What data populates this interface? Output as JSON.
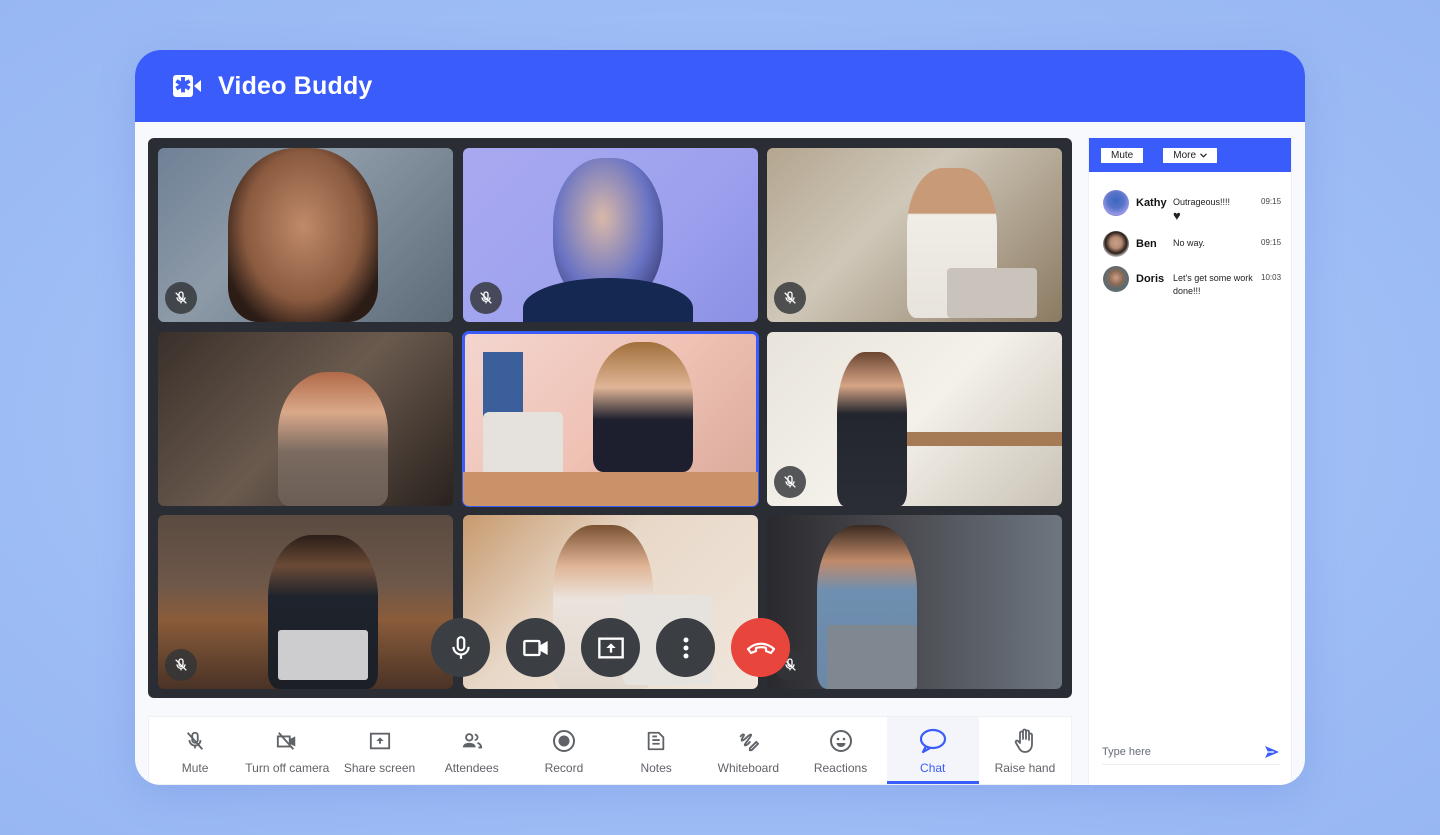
{
  "app": {
    "title": "Video Buddy",
    "logo_icon": "video-camera-icon"
  },
  "participants": [
    {
      "name": "participant-1",
      "muted": true,
      "active": false
    },
    {
      "name": "participant-2",
      "muted": true,
      "active": false
    },
    {
      "name": "participant-3",
      "muted": true,
      "active": false
    },
    {
      "name": "participant-4",
      "muted": false,
      "active": false
    },
    {
      "name": "participant-5",
      "muted": false,
      "active": true
    },
    {
      "name": "participant-6",
      "muted": true,
      "active": false
    },
    {
      "name": "participant-7",
      "muted": true,
      "active": false
    },
    {
      "name": "participant-8",
      "muted": false,
      "active": false
    },
    {
      "name": "participant-9",
      "muted": true,
      "active": false
    }
  ],
  "call_controls": [
    {
      "name": "microphone",
      "icon": "microphone-icon"
    },
    {
      "name": "camera",
      "icon": "video-camera-icon"
    },
    {
      "name": "share-screen",
      "icon": "share-screen-icon"
    },
    {
      "name": "more-options",
      "icon": "more-vertical-icon"
    },
    {
      "name": "end-call",
      "icon": "hang-up-icon"
    }
  ],
  "toolbar": {
    "items": [
      {
        "label": "Mute",
        "icon": "mic-off-icon"
      },
      {
        "label": "Turn off camera",
        "icon": "camera-off-icon"
      },
      {
        "label": "Share screen",
        "icon": "share-screen-icon"
      },
      {
        "label": "Attendees",
        "icon": "people-icon"
      },
      {
        "label": "Record",
        "icon": "record-icon"
      },
      {
        "label": "Notes",
        "icon": "notes-icon"
      },
      {
        "label": "Whiteboard",
        "icon": "whiteboard-icon"
      },
      {
        "label": "Reactions",
        "icon": "smiley-icon"
      },
      {
        "label": "Chat",
        "icon": "chat-bubble-icon"
      },
      {
        "label": "Raise hand",
        "icon": "hand-icon"
      }
    ],
    "active": "Chat"
  },
  "chat": {
    "mute_label": "Mute",
    "more_label": "More",
    "messages": [
      {
        "name": "Kathy",
        "text": "Outrageous!!!!",
        "extra": "♥",
        "time": "09:15"
      },
      {
        "name": "Ben",
        "text": "No way.",
        "extra": "",
        "time": "09:15"
      },
      {
        "name": "Doris",
        "text": "Let's get some work done!!!",
        "extra": "",
        "time": "10:03"
      }
    ],
    "input_placeholder": "Type here",
    "input_value": ""
  },
  "colors": {
    "brand": "#3a5cfa",
    "end_call": "#e8453c",
    "stage": "#2a2d34"
  }
}
